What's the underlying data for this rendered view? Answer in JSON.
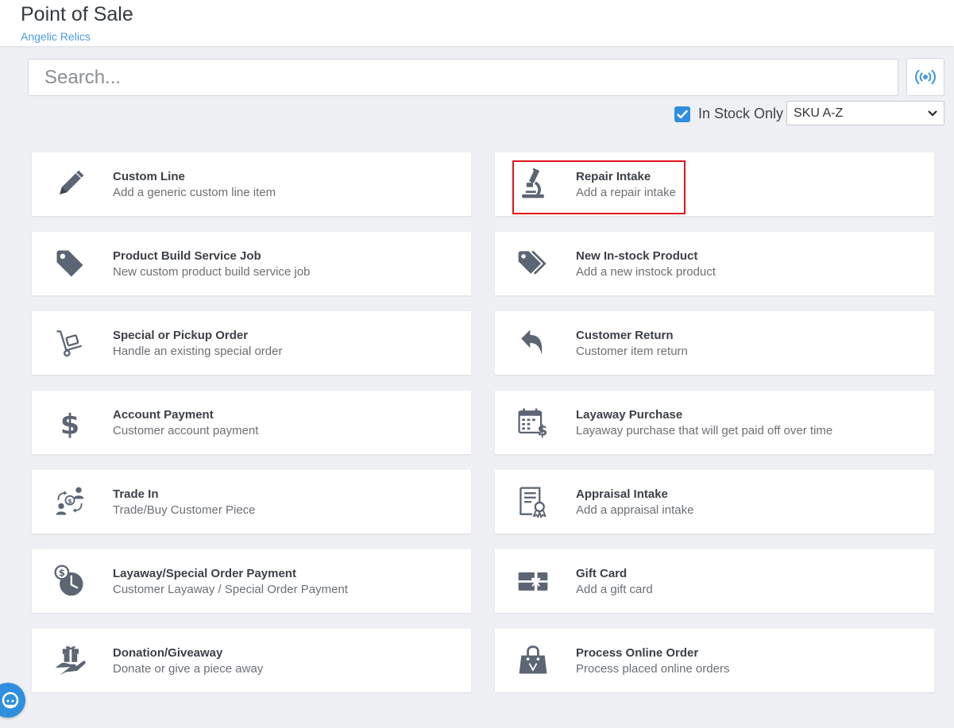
{
  "header": {
    "title": "Point of Sale",
    "store": "Angelic Relics"
  },
  "search": {
    "placeholder": "Search...",
    "value": ""
  },
  "filters": {
    "in_stock_label": "In Stock Only",
    "in_stock_checked": true,
    "sort_selected": "SKU A-Z"
  },
  "colors": {
    "accent": "#2f8fdd",
    "highlight": "#e0141b",
    "icon": "#5b6573"
  },
  "cards": [
    {
      "title": "Custom Line",
      "subtitle": "Add a generic custom line item",
      "icon": "pencil-icon"
    },
    {
      "title": "Repair Intake",
      "subtitle": "Add a repair intake",
      "icon": "microscope-icon"
    },
    {
      "title": "Product Build Service Job",
      "subtitle": "New custom product build service job",
      "icon": "tag-icon"
    },
    {
      "title": "New In-stock Product",
      "subtitle": "Add a new instock product",
      "icon": "tags-icon"
    },
    {
      "title": "Special or Pickup Order",
      "subtitle": "Handle an existing special order",
      "icon": "hand-truck-icon"
    },
    {
      "title": "Customer Return",
      "subtitle": "Customer item return",
      "icon": "return-arrow-icon"
    },
    {
      "title": "Account Payment",
      "subtitle": "Customer account payment",
      "icon": "dollar-icon"
    },
    {
      "title": "Layaway Purchase",
      "subtitle": "Layaway purchase that will get paid off over time",
      "icon": "calendar-dollar-icon"
    },
    {
      "title": "Trade In",
      "subtitle": "Trade/Buy Customer Piece",
      "icon": "trade-exchange-icon"
    },
    {
      "title": "Appraisal Intake",
      "subtitle": "Add a appraisal intake",
      "icon": "certificate-icon"
    },
    {
      "title": "Layaway/Special Order Payment",
      "subtitle": "Customer Layaway / Special Order Payment",
      "icon": "clock-dollar-icon"
    },
    {
      "title": "Gift Card",
      "subtitle": "Add a gift card",
      "icon": "gift-card-icon"
    },
    {
      "title": "Donation/Giveaway",
      "subtitle": "Donate or give a piece away",
      "icon": "hand-gift-icon"
    },
    {
      "title": "Process Online Order",
      "subtitle": "Process placed online orders",
      "icon": "shopping-bag-icon"
    }
  ]
}
